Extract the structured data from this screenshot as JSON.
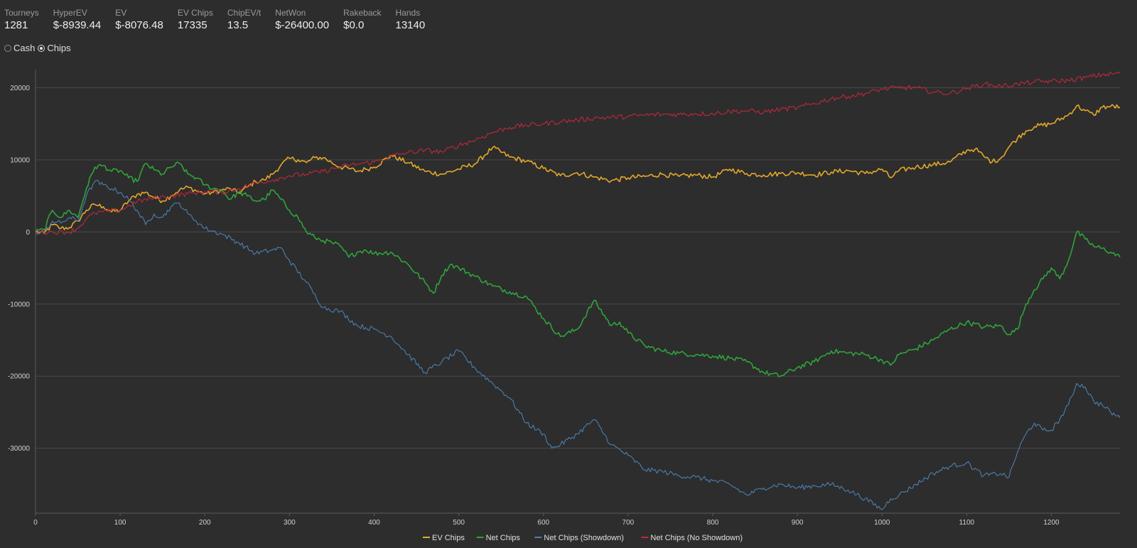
{
  "stats": [
    {
      "label": "Tourneys",
      "value": "1281"
    },
    {
      "label": "HyperEV",
      "value": "$-8939.44"
    },
    {
      "label": "EV",
      "value": "$-8076.48"
    },
    {
      "label": "EV Chips",
      "value": "17335"
    },
    {
      "label": "ChipEV/t",
      "value": "13.5"
    },
    {
      "label": "NetWon",
      "value": "$-26400.00"
    },
    {
      "label": "Rakeback",
      "value": "$0.0"
    },
    {
      "label": "Hands",
      "value": "13140"
    }
  ],
  "mode": {
    "options": [
      {
        "label": "Cash",
        "checked": false
      },
      {
        "label": "Chips",
        "checked": true
      }
    ]
  },
  "chart_data": {
    "type": "line",
    "title": "",
    "xlabel": "",
    "ylabel": "",
    "xlim": [
      0,
      1281
    ],
    "ylim": [
      -39000,
      22500
    ],
    "x_ticks": [
      0,
      100,
      200,
      300,
      400,
      500,
      600,
      700,
      800,
      900,
      1000,
      1100,
      1200
    ],
    "y_ticks": [
      20000,
      10000,
      0,
      -10000,
      -20000,
      -30000
    ],
    "grid": "horizontal",
    "legend_position": "bottom",
    "series": [
      {
        "name": "EV Chips",
        "color": "#e3a82b",
        "x": [
          0,
          10,
          20,
          30,
          40,
          50,
          60,
          70,
          80,
          90,
          100,
          110,
          120,
          130,
          140,
          150,
          160,
          170,
          180,
          190,
          200,
          210,
          220,
          230,
          240,
          250,
          260,
          270,
          280,
          290,
          300,
          310,
          320,
          330,
          340,
          350,
          360,
          370,
          380,
          390,
          400,
          420,
          440,
          460,
          480,
          500,
          520,
          540,
          560,
          580,
          600,
          620,
          640,
          660,
          680,
          700,
          720,
          740,
          760,
          780,
          800,
          820,
          840,
          860,
          880,
          900,
          920,
          940,
          960,
          980,
          1000,
          1010,
          1020,
          1040,
          1060,
          1080,
          1100,
          1110,
          1120,
          1130,
          1140,
          1150,
          1160,
          1170,
          1180,
          1200,
          1220,
          1230,
          1240,
          1250,
          1260,
          1270,
          1281
        ],
        "values": [
          0,
          -200,
          1000,
          500,
          600,
          1500,
          3000,
          3800,
          3500,
          2800,
          3000,
          4300,
          5200,
          5500,
          4800,
          4300,
          5000,
          5800,
          6200,
          5700,
          5300,
          5500,
          5800,
          6000,
          5400,
          6200,
          7000,
          7200,
          8000,
          9300,
          10200,
          10000,
          9600,
          10300,
          10300,
          9600,
          9000,
          8800,
          8400,
          8700,
          9000,
          10600,
          9600,
          8400,
          8000,
          8700,
          9500,
          11700,
          10400,
          9800,
          8800,
          7800,
          8200,
          7600,
          7100,
          7500,
          7700,
          8000,
          7700,
          7900,
          7600,
          8700,
          8100,
          7900,
          8100,
          8200,
          7900,
          8300,
          8500,
          8100,
          8700,
          7500,
          8500,
          9000,
          9300,
          9700,
          11300,
          11500,
          10500,
          9700,
          10200,
          11800,
          13000,
          14000,
          14600,
          15000,
          16200,
          17500,
          16800,
          16200,
          17300,
          17400,
          17335
        ]
      },
      {
        "name": "Net Chips",
        "color": "#2fa33b",
        "x": [
          0,
          10,
          20,
          30,
          40,
          50,
          60,
          70,
          80,
          90,
          100,
          110,
          120,
          130,
          140,
          150,
          160,
          170,
          180,
          190,
          200,
          210,
          220,
          230,
          240,
          250,
          260,
          270,
          280,
          290,
          300,
          310,
          320,
          330,
          340,
          350,
          360,
          370,
          380,
          390,
          400,
          420,
          440,
          460,
          470,
          480,
          490,
          500,
          520,
          540,
          560,
          580,
          600,
          620,
          640,
          660,
          680,
          690,
          700,
          720,
          740,
          760,
          780,
          800,
          820,
          840,
          860,
          880,
          900,
          920,
          940,
          960,
          980,
          1000,
          1010,
          1020,
          1040,
          1060,
          1080,
          1100,
          1120,
          1140,
          1150,
          1160,
          1170,
          1180,
          1190,
          1200,
          1210,
          1220,
          1230,
          1240,
          1250,
          1260,
          1270,
          1281
        ],
        "values": [
          0,
          300,
          3000,
          2000,
          3000,
          2000,
          6000,
          9000,
          9200,
          8400,
          8500,
          7500,
          7000,
          9500,
          8600,
          8000,
          9000,
          9500,
          8000,
          7500,
          6500,
          6000,
          5800,
          4500,
          5500,
          5000,
          4300,
          4500,
          5800,
          4500,
          3000,
          2000,
          0,
          -800,
          -1200,
          -1500,
          -2000,
          -3500,
          -2800,
          -2500,
          -3000,
          -2800,
          -4500,
          -7000,
          -8500,
          -6000,
          -4500,
          -5000,
          -6200,
          -7500,
          -8300,
          -9000,
          -12000,
          -14500,
          -13500,
          -9500,
          -13000,
          -12500,
          -14000,
          -15800,
          -16500,
          -16800,
          -17000,
          -17200,
          -17500,
          -18000,
          -19500,
          -20000,
          -18800,
          -18000,
          -16500,
          -16800,
          -17000,
          -17800,
          -18500,
          -17000,
          -16200,
          -15000,
          -13500,
          -12500,
          -13200,
          -13000,
          -14200,
          -13500,
          -10000,
          -8000,
          -6500,
          -5000,
          -6500,
          -4000,
          0,
          -1000,
          -2000,
          -2300,
          -2800,
          -3500
        ]
      },
      {
        "name": "Net Chips (Showdown)",
        "color": "#4d7fb0",
        "x": [
          0,
          10,
          20,
          30,
          40,
          50,
          60,
          70,
          80,
          90,
          100,
          110,
          120,
          130,
          140,
          150,
          160,
          170,
          180,
          190,
          200,
          220,
          240,
          260,
          280,
          290,
          300,
          320,
          340,
          360,
          380,
          400,
          420,
          440,
          460,
          480,
          500,
          520,
          540,
          560,
          580,
          600,
          610,
          620,
          640,
          660,
          680,
          700,
          720,
          740,
          760,
          780,
          800,
          820,
          840,
          860,
          880,
          900,
          920,
          940,
          960,
          980,
          1000,
          1010,
          1020,
          1040,
          1060,
          1080,
          1100,
          1120,
          1140,
          1150,
          1160,
          1170,
          1180,
          1190,
          1200,
          1210,
          1220,
          1230,
          1240,
          1250,
          1260,
          1270,
          1281
        ],
        "values": [
          0,
          -100,
          1500,
          1200,
          2000,
          1500,
          5000,
          7000,
          6500,
          6000,
          5500,
          4500,
          3000,
          1000,
          2500,
          2000,
          3500,
          4000,
          2500,
          1500,
          500,
          -300,
          -1500,
          -3000,
          -2500,
          -2200,
          -4000,
          -7000,
          -10500,
          -11000,
          -13000,
          -13500,
          -14500,
          -17000,
          -19500,
          -18000,
          -16500,
          -19000,
          -21000,
          -23000,
          -26500,
          -28000,
          -30000,
          -29500,
          -28000,
          -26000,
          -29500,
          -31000,
          -33000,
          -33200,
          -33800,
          -34000,
          -34500,
          -35000,
          -36500,
          -35500,
          -35000,
          -35500,
          -35200,
          -35000,
          -35800,
          -37000,
          -38500,
          -37000,
          -36500,
          -35000,
          -33500,
          -32500,
          -32000,
          -33800,
          -33500,
          -34000,
          -30500,
          -28000,
          -26500,
          -27500,
          -27500,
          -26000,
          -24000,
          -21000,
          -21500,
          -23500,
          -24000,
          -25000,
          -25800
        ]
      },
      {
        "name": "Net Chips (No Showdown)",
        "color": "#c0283b",
        "x": [
          0,
          20,
          40,
          50,
          60,
          70,
          80,
          100,
          120,
          140,
          160,
          180,
          200,
          220,
          240,
          260,
          280,
          300,
          320,
          340,
          360,
          380,
          400,
          420,
          440,
          460,
          480,
          500,
          520,
          540,
          560,
          580,
          600,
          620,
          640,
          660,
          680,
          700,
          720,
          740,
          760,
          780,
          800,
          820,
          840,
          860,
          880,
          900,
          920,
          940,
          960,
          980,
          1000,
          1020,
          1040,
          1060,
          1080,
          1100,
          1120,
          1140,
          1160,
          1180,
          1200,
          1220,
          1240,
          1260,
          1281
        ],
        "values": [
          0,
          0,
          0,
          500,
          1800,
          2600,
          2800,
          3000,
          4200,
          4700,
          5000,
          5300,
          5600,
          5500,
          6000,
          6800,
          7200,
          7800,
          8000,
          8400,
          9000,
          9400,
          9700,
          10500,
          11000,
          11300,
          11100,
          12000,
          12800,
          13800,
          14500,
          14800,
          15000,
          15300,
          15500,
          15800,
          15900,
          16000,
          16200,
          16300,
          16300,
          16400,
          16400,
          16700,
          16800,
          16600,
          17000,
          17200,
          17800,
          18500,
          18800,
          19200,
          19800,
          20000,
          20000,
          19400,
          19200,
          19900,
          20500,
          20200,
          20500,
          20800,
          20900,
          21000,
          21400,
          21800,
          22000
        ]
      }
    ]
  }
}
